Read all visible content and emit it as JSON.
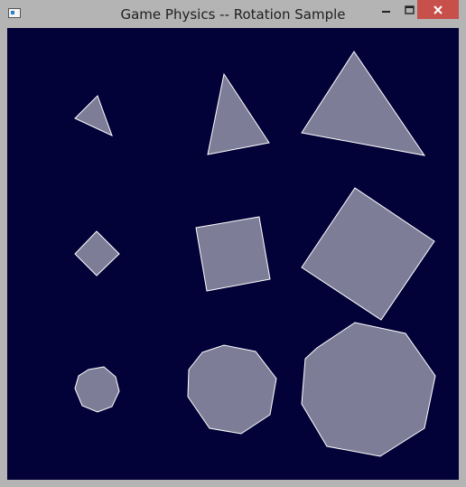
{
  "window": {
    "title": "Game Physics -- Rotation Sample",
    "background_color": "#b4b4b4",
    "canvas_color": "#020138",
    "shape_fill": "#7d7d98",
    "shape_stroke": "#ffffff",
    "controls": {
      "minimize_icon": "minimize-icon",
      "maximize_icon": "maximize-icon",
      "close_icon": "close-icon",
      "close_color": "#c7504b"
    }
  },
  "shapes": [
    {
      "kind": "triangle",
      "size": "small",
      "row": 1,
      "col": 1
    },
    {
      "kind": "triangle",
      "size": "medium",
      "row": 1,
      "col": 2
    },
    {
      "kind": "triangle",
      "size": "large",
      "row": 1,
      "col": 3
    },
    {
      "kind": "square",
      "size": "small",
      "row": 2,
      "col": 1
    },
    {
      "kind": "square",
      "size": "medium",
      "row": 2,
      "col": 2
    },
    {
      "kind": "square",
      "size": "large",
      "row": 2,
      "col": 3
    },
    {
      "kind": "octagon",
      "size": "small",
      "row": 3,
      "col": 1
    },
    {
      "kind": "octagon",
      "size": "medium",
      "row": 3,
      "col": 2
    },
    {
      "kind": "octagon",
      "size": "large",
      "row": 3,
      "col": 3
    }
  ]
}
